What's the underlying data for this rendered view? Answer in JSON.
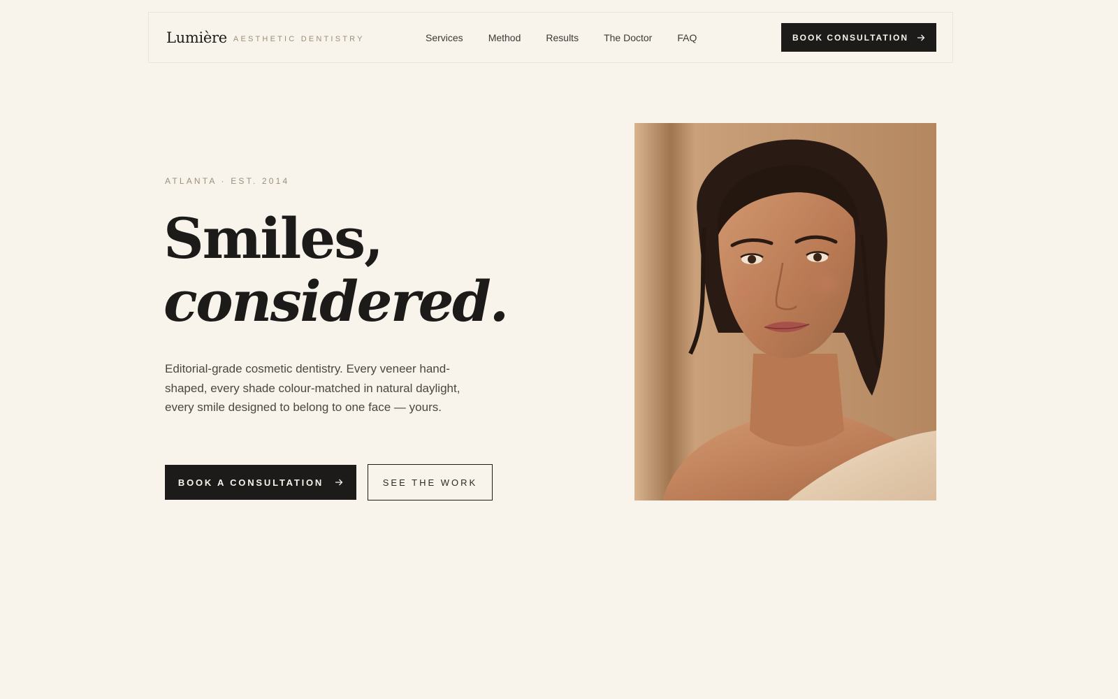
{
  "nav": {
    "brand_name": "Lumière",
    "brand_tagline": "AESTHETIC DENTISTRY",
    "links": [
      "Services",
      "Method",
      "Results",
      "The Doctor",
      "FAQ"
    ],
    "cta_label": "BOOK CONSULTATION",
    "cta_icon": "arrow-right-icon"
  },
  "hero": {
    "eyebrow": "ATLANTA · EST. 2014",
    "headline_line1": "Smiles,",
    "headline_line2": "considered.",
    "lede": "Editorial-grade cosmetic dentistry. Every veneer hand-shaped, every shade colour-matched in natural daylight, every smile designed to belong to one face — yours.",
    "primary_cta": "BOOK A CONSULTATION",
    "secondary_cta": "SEE THE WORK"
  },
  "colors": {
    "background": "#f8f4ec",
    "ink": "#1c1b19",
    "muted_gold": "#9c8e78",
    "body_text": "#4a4741"
  }
}
